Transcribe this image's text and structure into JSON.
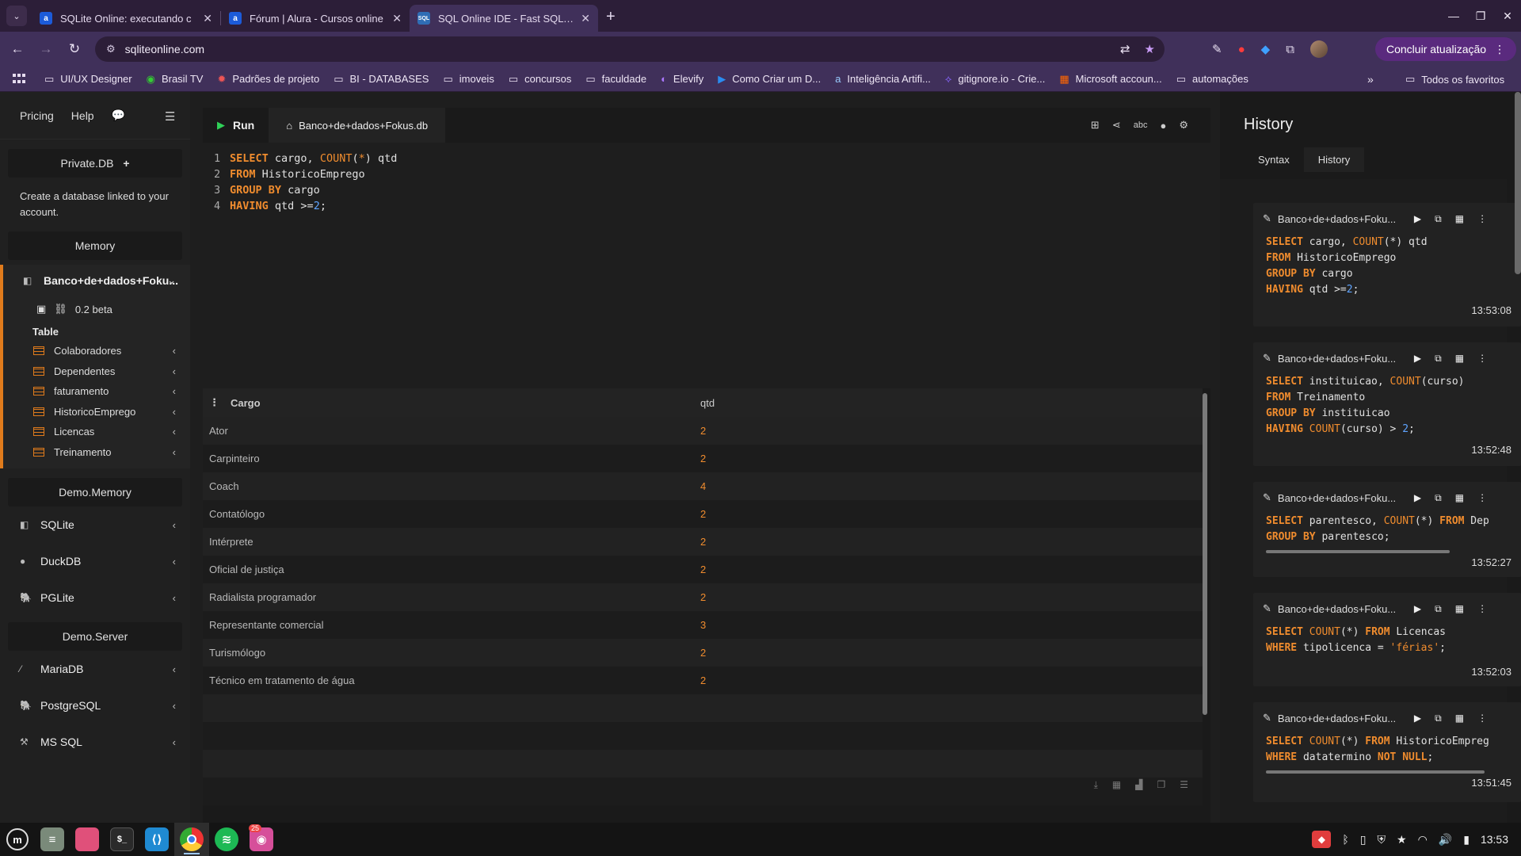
{
  "browser": {
    "tabs": [
      {
        "title": "SQLite Online: executando c",
        "icon": "alura-icon",
        "active": false
      },
      {
        "title": "Fórum | Alura - Cursos online",
        "icon": "alura-icon",
        "active": false
      },
      {
        "title": "SQL Online IDE - Fast SQL Ed",
        "icon": "sqlonline-icon",
        "active": true
      }
    ],
    "url": "sqliteonline.com",
    "update_label": "Concluir atualização",
    "bookmarks": [
      "UI/UX Designer",
      "Brasil TV",
      "Padrões de projeto",
      "BI - DATABASES",
      "imoveis",
      "concursos",
      "faculdade",
      "Elevify",
      "Como Criar um D...",
      "Inteligência Artifi...",
      "gitignore.io - Crie...",
      "Microsoft accoun...",
      "automações"
    ],
    "bookmarks_all": "Todos os favoritos",
    "bookmarks_more": "»"
  },
  "sidebar": {
    "top_links": [
      "Pricing",
      "Help"
    ],
    "private_db": "Private.DB",
    "private_desc": "Create a database linked to your account.",
    "memory_label": "Memory",
    "active_db": "Banco+de+dados+Foku...",
    "version": "0.2 beta",
    "table_label": "Table",
    "tables": [
      "Colaboradores",
      "Dependentes",
      "faturamento",
      "HistoricoEmprego",
      "Licencas",
      "Treinamento"
    ],
    "demo_memory_label": "Demo.Memory",
    "demo_memory": [
      "SQLite",
      "DuckDB",
      "PGLite"
    ],
    "demo_server_label": "Demo.Server",
    "demo_server": [
      "MariaDB",
      "PostgreSQL",
      "MS SQL"
    ]
  },
  "editor": {
    "run_label": "Run",
    "file_tab": "Banco+de+dados+Fokus.db",
    "spell_label": "abc"
  },
  "results": {
    "columns": [
      "Cargo",
      "qtd"
    ],
    "rows": [
      [
        "Ator",
        "2"
      ],
      [
        "Carpinteiro",
        "2"
      ],
      [
        "Coach",
        "4"
      ],
      [
        "Contatólogo",
        "2"
      ],
      [
        "Intérprete",
        "2"
      ],
      [
        "Oficial de justiça",
        "2"
      ],
      [
        "Radialista programador",
        "2"
      ],
      [
        "Representante comercial",
        "3"
      ],
      [
        "Turismólogo",
        "2"
      ],
      [
        "Técnico em tratamento de água",
        "2"
      ]
    ]
  },
  "history": {
    "title": "History",
    "tabs": [
      "Syntax",
      "History"
    ],
    "entries": [
      {
        "name": "Banco+de+dados+Foku...",
        "time": "13:53:08"
      },
      {
        "name": "Banco+de+dados+Foku...",
        "time": "13:52:48"
      },
      {
        "name": "Banco+de+dados+Foku...",
        "time": "13:52:27"
      },
      {
        "name": "Banco+de+dados+Foku...",
        "time": "13:52:03"
      },
      {
        "name": "Banco+de+dados+Foku...",
        "time": "13:51:45"
      }
    ]
  },
  "taskbar": {
    "clock": "13:53",
    "badge": "25"
  },
  "colors": {
    "accent": "#e07b1c",
    "run_green": "#30d158",
    "number_blue": "#5fa4ff"
  }
}
